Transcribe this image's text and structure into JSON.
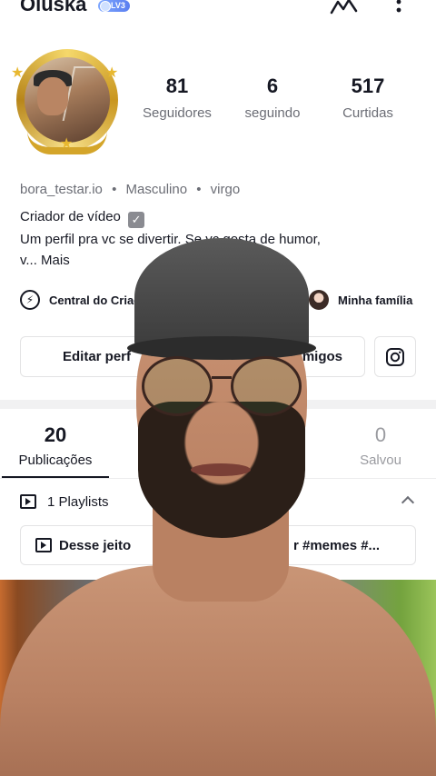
{
  "header": {
    "username": "Oluska",
    "level_badge": "LV3"
  },
  "stats": [
    {
      "value": "81",
      "label": "Seguidores"
    },
    {
      "value": "6",
      "label": "seguindo"
    },
    {
      "value": "517",
      "label": "Curtidas"
    }
  ],
  "bio": {
    "handle": "bora_testar.io",
    "gender": "Masculino",
    "sign": "virgo",
    "line1": "Criador de vídeo",
    "line2": "Um perfil pra vc se divertir. Se vc gosta de humor,",
    "line3": "v... Mais"
  },
  "links": {
    "creator_center": "Central do Criad",
    "family": "Minha família"
  },
  "buttons": {
    "edit_profile": "Editar perf",
    "friends": "migos"
  },
  "tabs": [
    {
      "value": "20",
      "label": "Publicações"
    },
    {
      "value": "0",
      "label": "Salvou"
    }
  ],
  "playlists": {
    "header": "1 Playlists",
    "card_left": "Desse jeito",
    "card_right": "r #memes #..."
  }
}
